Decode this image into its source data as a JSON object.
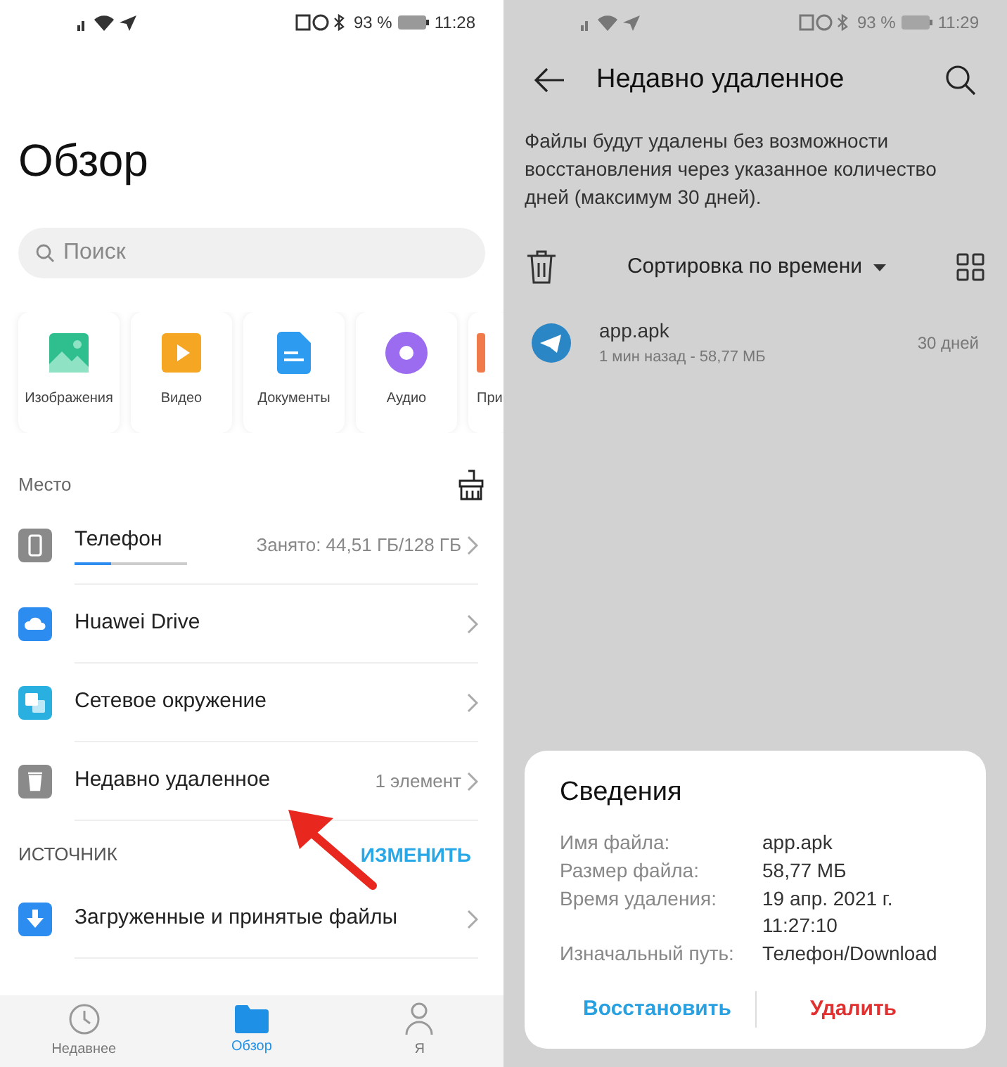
{
  "left": {
    "status_bar": {
      "battery": "93 %",
      "time": "11:28"
    },
    "title": "Обзор",
    "search": {
      "placeholder": "Поиск"
    },
    "categories": [
      {
        "kind": "images",
        "label": "Изображения"
      },
      {
        "kind": "video",
        "label": "Видео"
      },
      {
        "kind": "documents",
        "label": "Документы"
      },
      {
        "kind": "audio",
        "label": "Аудио"
      },
      {
        "kind": "apps",
        "label": "При"
      }
    ],
    "storage": {
      "heading": "Место",
      "items": [
        {
          "kind": "phone",
          "label": "Телефон",
          "level": 0.33,
          "detail": "Занято: 44,51 ГБ/128 ГБ"
        },
        {
          "kind": "cloud",
          "label": "Huawei Drive"
        },
        {
          "kind": "network",
          "label": "Сетевое окружение"
        },
        {
          "kind": "trash",
          "label": "Недавно удаленное",
          "detail": "1 элемент"
        }
      ]
    },
    "sources": {
      "heading": "ИСТОЧНИК",
      "action": "ИЗМЕНИТЬ",
      "items": [
        {
          "kind": "download",
          "label": "Загруженные и принятые файлы"
        }
      ]
    },
    "tabs": [
      {
        "kind": "recent",
        "label": "Недавнее",
        "selected": false
      },
      {
        "kind": "browse",
        "label": "Обзор",
        "selected": true
      },
      {
        "kind": "me",
        "label": "Я",
        "selected": false
      }
    ]
  },
  "right": {
    "status_bar": {
      "battery": "93 %",
      "time": "11:29"
    },
    "title": "Недавно удаленное",
    "notice": "Файлы будут удалены без возможности восстановления через указанное количество дней (максимум 30 дней).",
    "sort": "Сортировка по времени",
    "files": [
      {
        "name": "app.apk",
        "meta": "1 мин назад - 58,77 МБ",
        "days": "30 дней"
      }
    ],
    "dialog": {
      "title": "Сведения",
      "rows": [
        {
          "label": "Имя файла:",
          "value": "app.apk"
        },
        {
          "label": "Размер файла:",
          "value": "58,77 МБ"
        },
        {
          "label": "Время удаления:",
          "value": "19 апр. 2021 г. 11:27:10"
        },
        {
          "label": "Изначальный путь:",
          "value": "Телефон/Download"
        }
      ],
      "buttons": [
        {
          "kind": "restore",
          "label": "Восстановить"
        },
        {
          "kind": "delete",
          "label": "Удалить"
        }
      ]
    }
  }
}
